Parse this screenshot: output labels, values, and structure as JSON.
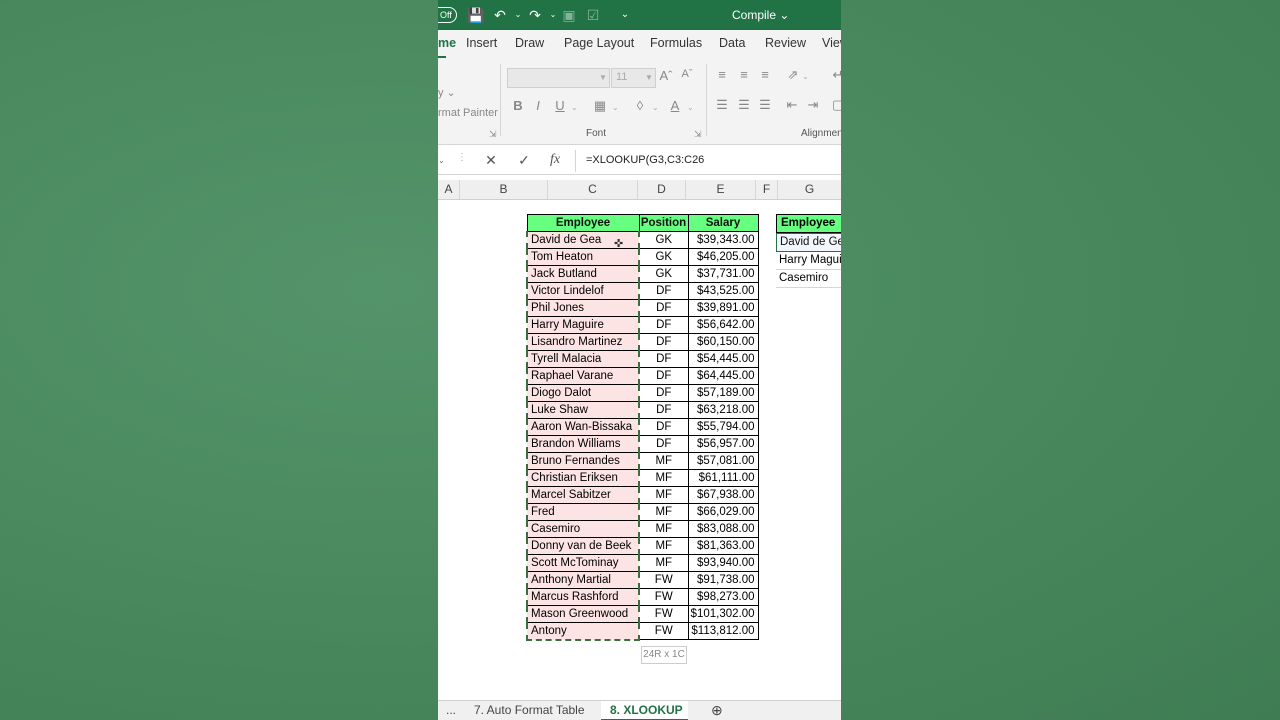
{
  "titlebar": {
    "autosave": "Off",
    "doc_title": "Compile ⌄"
  },
  "ribbon_tabs": [
    "me",
    "Insert",
    "Draw",
    "Page Layout",
    "Formulas",
    "Data",
    "Review",
    "View"
  ],
  "ribbon": {
    "font_size": "11",
    "font_group_label": "Font",
    "alignment_group_label": "Alignment",
    "format_painter": "rmat Painter",
    "copy_fragment": "y ⌄"
  },
  "formula_bar": {
    "formula": "=XLOOKUP(G3,C3:C26"
  },
  "columns": [
    "A",
    "B",
    "C",
    "D",
    "E",
    "F",
    "G"
  ],
  "table": {
    "headers": [
      "Employee",
      "Position",
      "Salary"
    ],
    "rows": [
      [
        "David de Gea",
        "GK",
        "$39,343.00"
      ],
      [
        "Tom Heaton",
        "GK",
        "$46,205.00"
      ],
      [
        "Jack Butland",
        "GK",
        "$37,731.00"
      ],
      [
        "Victor Lindelof",
        "DF",
        "$43,525.00"
      ],
      [
        "Phil Jones",
        "DF",
        "$39,891.00"
      ],
      [
        "Harry Maguire",
        "DF",
        "$56,642.00"
      ],
      [
        "Lisandro Martinez",
        "DF",
        "$60,150.00"
      ],
      [
        "Tyrell Malacia",
        "DF",
        "$54,445.00"
      ],
      [
        "Raphael Varane",
        "DF",
        "$64,445.00"
      ],
      [
        "Diogo Dalot",
        "DF",
        "$57,189.00"
      ],
      [
        "Luke Shaw",
        "DF",
        "$63,218.00"
      ],
      [
        "Aaron Wan-Bissaka",
        "DF",
        "$55,794.00"
      ],
      [
        "Brandon Williams",
        "DF",
        "$56,957.00"
      ],
      [
        "Bruno Fernandes",
        "MF",
        "$57,081.00"
      ],
      [
        "Christian Eriksen",
        "MF",
        "$61,111.00"
      ],
      [
        "Marcel Sabitzer",
        "MF",
        "$67,938.00"
      ],
      [
        "Fred",
        "MF",
        "$66,029.00"
      ],
      [
        "Casemiro",
        "MF",
        "$83,088.00"
      ],
      [
        "Donny van de Beek",
        "MF",
        "$81,363.00"
      ],
      [
        "Scott McTominay",
        "MF",
        "$93,940.00"
      ],
      [
        "Anthony Martial",
        "FW",
        "$91,738.00"
      ],
      [
        "Marcus Rashford",
        "FW",
        "$98,273.00"
      ],
      [
        "Mason Greenwood",
        "FW",
        "$101,302.00"
      ],
      [
        "Antony",
        "FW",
        "$113,812.00"
      ]
    ]
  },
  "selection_tooltip": "24R x 1C",
  "lookup": {
    "header": "Employee",
    "values": [
      "David de Gea",
      "Harry Maguire",
      "Casemiro"
    ]
  },
  "sheet_tabs": {
    "more": "...",
    "prev": "7. Auto Format Table",
    "active": "8. XLOOKUP",
    "add": "⊕"
  }
}
